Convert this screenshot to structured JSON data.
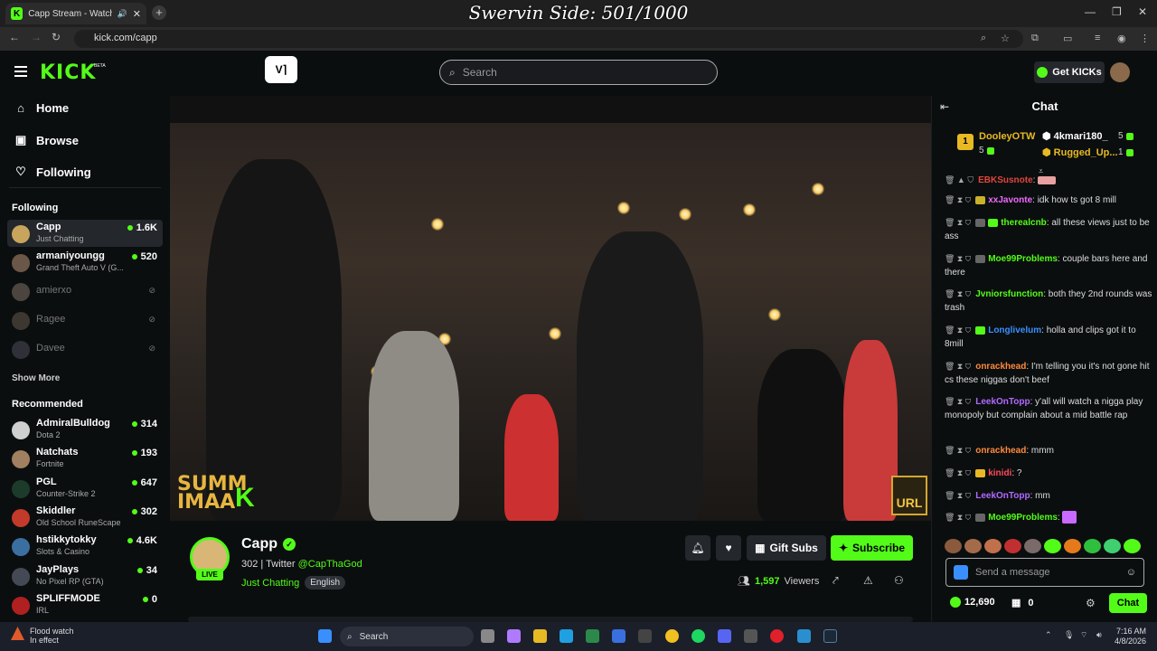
{
  "browser": {
    "tab_title": "Capp Stream - Watch Live",
    "url": "kick.com/capp",
    "overlay_title": "Swervin Side: 501/1000"
  },
  "header": {
    "logo": "KICK",
    "logo_badge": "BETA",
    "search_placeholder": "Search",
    "get_kicks": "Get KICKs"
  },
  "sidebar": {
    "nav": [
      {
        "label": "Home",
        "icon": "home-icon"
      },
      {
        "label": "Browse",
        "icon": "browse-icon"
      },
      {
        "label": "Following",
        "icon": "heart-icon"
      }
    ],
    "following_header": "Following",
    "following": [
      {
        "name": "Capp",
        "category": "Just Chatting",
        "viewers": "1.6K",
        "live": true,
        "color": "#c8a55c"
      },
      {
        "name": "armaniyoungg",
        "category": "Grand Theft Auto V (G...",
        "viewers": "520",
        "live": true,
        "color": "#6b5747"
      },
      {
        "name": "amierxo",
        "category": "",
        "viewers": "",
        "live": false,
        "color": "#9b8a7a"
      },
      {
        "name": "Ragee",
        "category": "",
        "viewers": "",
        "live": false,
        "color": "#7a6a5a"
      },
      {
        "name": "Davee",
        "category": "",
        "viewers": "",
        "live": false,
        "color": "#5a5a6a"
      }
    ],
    "show_more": "Show More",
    "recommended_header": "Recommended",
    "recommended": [
      {
        "name": "AdmiralBulldog",
        "category": "Dota 2",
        "viewers": "314",
        "color": "#cfcfcf"
      },
      {
        "name": "Natchats",
        "category": "Fortnite",
        "viewers": "193",
        "color": "#a08060"
      },
      {
        "name": "PGL",
        "category": "Counter-Strike 2",
        "viewers": "647",
        "color": "#1d3b2a"
      },
      {
        "name": "Skiddler",
        "category": "Old School RuneScape",
        "viewers": "302",
        "color": "#c23a2a"
      },
      {
        "name": "hstikkytokky",
        "category": "Slots & Casino",
        "viewers": "4.6K",
        "color": "#3b6fa0"
      },
      {
        "name": "JayPlays",
        "category": "No Pixel RP (GTA)",
        "viewers": "34",
        "color": "#444a55"
      },
      {
        "name": "SPLIFFMODE",
        "category": "IRL",
        "viewers": "0",
        "color": "#b02020"
      }
    ]
  },
  "video": {
    "watermark_left": "SUMM\nIMAA",
    "watermark_k": "K",
    "badge_right": "URL"
  },
  "channel": {
    "name": "Capp",
    "live_label": "LIVE",
    "followers": "302",
    "twitter_label": "Twitter",
    "twitter_handle": "@CapThaGod",
    "category": "Just Chatting",
    "language": "English",
    "gift_subs": "Gift Subs",
    "subscribe": "Subscribe",
    "viewers_count": "1,597",
    "viewers_label": "Viewers"
  },
  "chat": {
    "title": "Chat",
    "leaderboard": {
      "first": {
        "rank": "1",
        "name": "DooleyOTW",
        "count": "5"
      },
      "second": {
        "name": "4kmari180_",
        "count": "5"
      },
      "third": {
        "name": "Rugged_Up...",
        "count": "1"
      }
    },
    "messages": [
      {
        "user": "EBKSusnote",
        "color": "#e0463b",
        "text": ""
      },
      {
        "user": "xxJavonte",
        "color": "#f06aff",
        "text": "idk how ts got 8 mill"
      },
      {
        "user": "therealcnb",
        "color": "#53fc18",
        "text": "all these views just to be ass"
      },
      {
        "user": "Moe99Problems",
        "color": "#53fc18",
        "text": "couple bars here and there"
      },
      {
        "user": "Jvniorsfunction",
        "color": "#53fc18",
        "text": "both they 2nd rounds was trash"
      },
      {
        "user": "Longlivelum",
        "color": "#3a8fff",
        "text": "holla and clips got it to 8mill"
      },
      {
        "user": "onrackhead",
        "color": "#ff8a3d",
        "text": "I'm telling you it's not gone hit cs these niggas don't beef"
      },
      {
        "user": "LeekOnTopp",
        "color": "#b06aff",
        "text": "y'all will watch a nigga play monopoly but complain about a mid battle rap"
      },
      {
        "user": "onrackhead",
        "color": "#ff8a3d",
        "text": "mmm"
      },
      {
        "user": "kinidi",
        "color": "#ff4a5a",
        "text": "?"
      },
      {
        "user": "LeekOnTopp",
        "color": "#b06aff",
        "text": "mm"
      },
      {
        "user": "Moe99Problems",
        "color": "#53fc18",
        "text": ""
      }
    ],
    "send_placeholder": "Send a message",
    "kicks_balance": "12,690",
    "sub_count": "0",
    "chat_button": "Chat"
  },
  "taskbar": {
    "weather_title": "Flood watch",
    "weather_sub": "In effect",
    "search": "Search",
    "time": "7:16 AM",
    "date": "4/8/2026"
  }
}
